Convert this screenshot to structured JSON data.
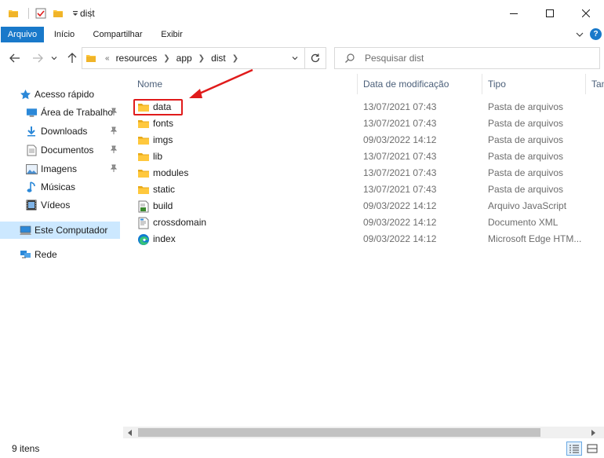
{
  "window": {
    "title": "dist"
  },
  "ribbon": {
    "tabs": [
      "Arquivo",
      "Início",
      "Compartilhar",
      "Exibir"
    ]
  },
  "address": {
    "overflow": "«",
    "crumbs": [
      "resources",
      "app",
      "dist"
    ]
  },
  "search": {
    "placeholder": "Pesquisar dist"
  },
  "navpane": {
    "quick_access": "Acesso rápido",
    "items": [
      {
        "label": "Área de Trabalho",
        "icon": "desktop-icon",
        "pinned": true
      },
      {
        "label": "Downloads",
        "icon": "download-icon",
        "pinned": true
      },
      {
        "label": "Documentos",
        "icon": "document-icon",
        "pinned": true
      },
      {
        "label": "Imagens",
        "icon": "pictures-icon",
        "pinned": true
      },
      {
        "label": "Músicas",
        "icon": "music-icon",
        "pinned": false
      },
      {
        "label": "Vídeos",
        "icon": "video-icon",
        "pinned": false
      }
    ],
    "this_pc": "Este Computador",
    "network": "Rede"
  },
  "columns": {
    "name": "Nome",
    "date": "Data de modificação",
    "type": "Tipo",
    "size": "Tam"
  },
  "files": [
    {
      "name": "data",
      "date": "13/07/2021 07:43",
      "type": "Pasta de arquivos",
      "icon": "folder-icon"
    },
    {
      "name": "fonts",
      "date": "13/07/2021 07:43",
      "type": "Pasta de arquivos",
      "icon": "folder-icon"
    },
    {
      "name": "imgs",
      "date": "09/03/2022 14:12",
      "type": "Pasta de arquivos",
      "icon": "folder-icon"
    },
    {
      "name": "lib",
      "date": "13/07/2021 07:43",
      "type": "Pasta de arquivos",
      "icon": "folder-icon"
    },
    {
      "name": "modules",
      "date": "13/07/2021 07:43",
      "type": "Pasta de arquivos",
      "icon": "folder-icon"
    },
    {
      "name": "static",
      "date": "13/07/2021 07:43",
      "type": "Pasta de arquivos",
      "icon": "folder-icon"
    },
    {
      "name": "build",
      "date": "09/03/2022 14:12",
      "type": "Arquivo JavaScript",
      "icon": "javascript-file-icon"
    },
    {
      "name": "crossdomain",
      "date": "09/03/2022 14:12",
      "type": "Documento XML",
      "icon": "xml-file-icon"
    },
    {
      "name": "index",
      "date": "09/03/2022 14:12",
      "type": "Microsoft Edge HTM...",
      "icon": "edge-html-icon"
    }
  ],
  "status": {
    "count": "9 itens"
  },
  "colors": {
    "accent": "#1979ca",
    "selection": "#cce8ff",
    "folder": "#ffc83d",
    "annotation": "#e01b1b"
  }
}
